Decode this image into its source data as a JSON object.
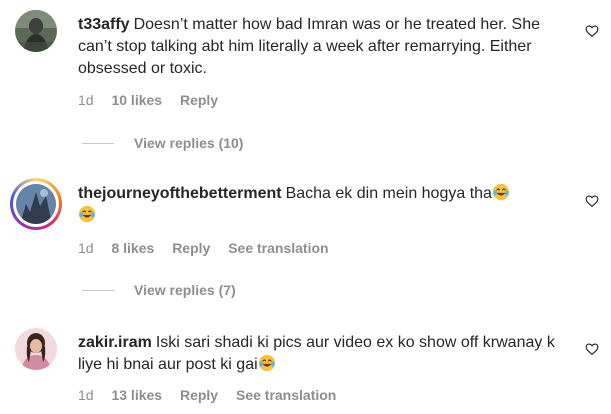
{
  "comments": [
    {
      "username": "t33affy",
      "text": "Doesn’t matter how bad Imran was or he treated her. She can’t stop talking abt him literally a week after remarrying. Either obsessed or toxic.",
      "age": "1d",
      "likes": "10 likes",
      "reply": "Reply",
      "view_replies": "View replies (10)"
    },
    {
      "username": "thejourneyofthebetterment",
      "text": "Bacha ek din mein hogya tha",
      "age": "1d",
      "likes": "8 likes",
      "reply": "Reply",
      "see_translation": "See translation",
      "view_replies": "View replies (7)",
      "has_story_ring": true
    },
    {
      "username": "zakir.iram",
      "text": "Iski sari shadi ki pics aur video ex ko show off krwanay k liye hi bnai aur post ki gai",
      "age": "1d",
      "likes": "13 likes",
      "reply": "Reply",
      "see_translation": "See translation"
    }
  ],
  "icons": {
    "like": "heart-outline-icon",
    "emoji": "laughing-tears-emoji"
  }
}
